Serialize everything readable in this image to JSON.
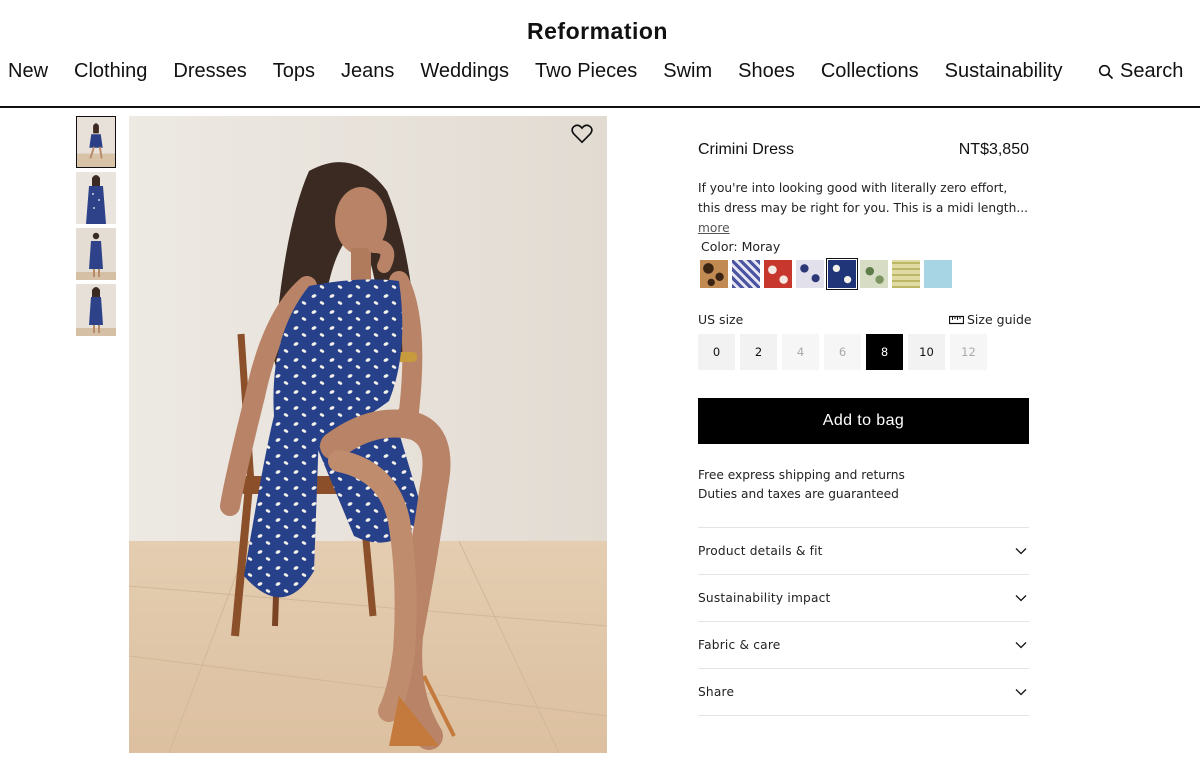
{
  "brand": {
    "name": "Reformation"
  },
  "nav": {
    "items": [
      "New",
      "Clothing",
      "Dresses",
      "Tops",
      "Jeans",
      "Weddings",
      "Two Pieces",
      "Swim",
      "Shoes",
      "Collections",
      "Sustainability"
    ],
    "search_label": "Search",
    "search_icon": "search-icon"
  },
  "gallery": {
    "thumbnails": [
      "thumb-1",
      "thumb-2",
      "thumb-3",
      "thumb-4"
    ],
    "active_index": 0,
    "wishlist_icon": "heart-icon"
  },
  "product": {
    "name": "Crimini Dress",
    "price": "NT$3,850",
    "description": "If you're into looking good with literally zero effort, this dress may be right for you. This is a midi length...",
    "more_label": "more",
    "color_label": "Color: Moray",
    "swatches": [
      {
        "name": "leopard",
        "color": "#8b5a2b"
      },
      {
        "name": "blue-floral",
        "color": "#6b75b8"
      },
      {
        "name": "red-floral",
        "color": "#c8372d"
      },
      {
        "name": "navy-dot",
        "color": "#8f93b7"
      },
      {
        "name": "moray",
        "color": "#1f3577",
        "selected": true
      },
      {
        "name": "green-floral",
        "color": "#9aae80"
      },
      {
        "name": "yellow-check",
        "color": "#d9d6a0"
      },
      {
        "name": "light-blue",
        "color": "#a7d5e3"
      }
    ],
    "size_label": "US size",
    "size_guide_label": "Size guide",
    "sizes": [
      {
        "label": "0",
        "available": true
      },
      {
        "label": "2",
        "available": true
      },
      {
        "label": "4",
        "available": false
      },
      {
        "label": "6",
        "available": false
      },
      {
        "label": "8",
        "available": true,
        "selected": true
      },
      {
        "label": "10",
        "available": true
      },
      {
        "label": "12",
        "available": false
      }
    ],
    "add_to_bag_label": "Add to bag",
    "shipping_line1": "Free express shipping and returns",
    "shipping_line2": "Duties and taxes are guaranteed",
    "accordion": [
      "Product details & fit",
      "Sustainability impact",
      "Fabric & care",
      "Share"
    ]
  }
}
